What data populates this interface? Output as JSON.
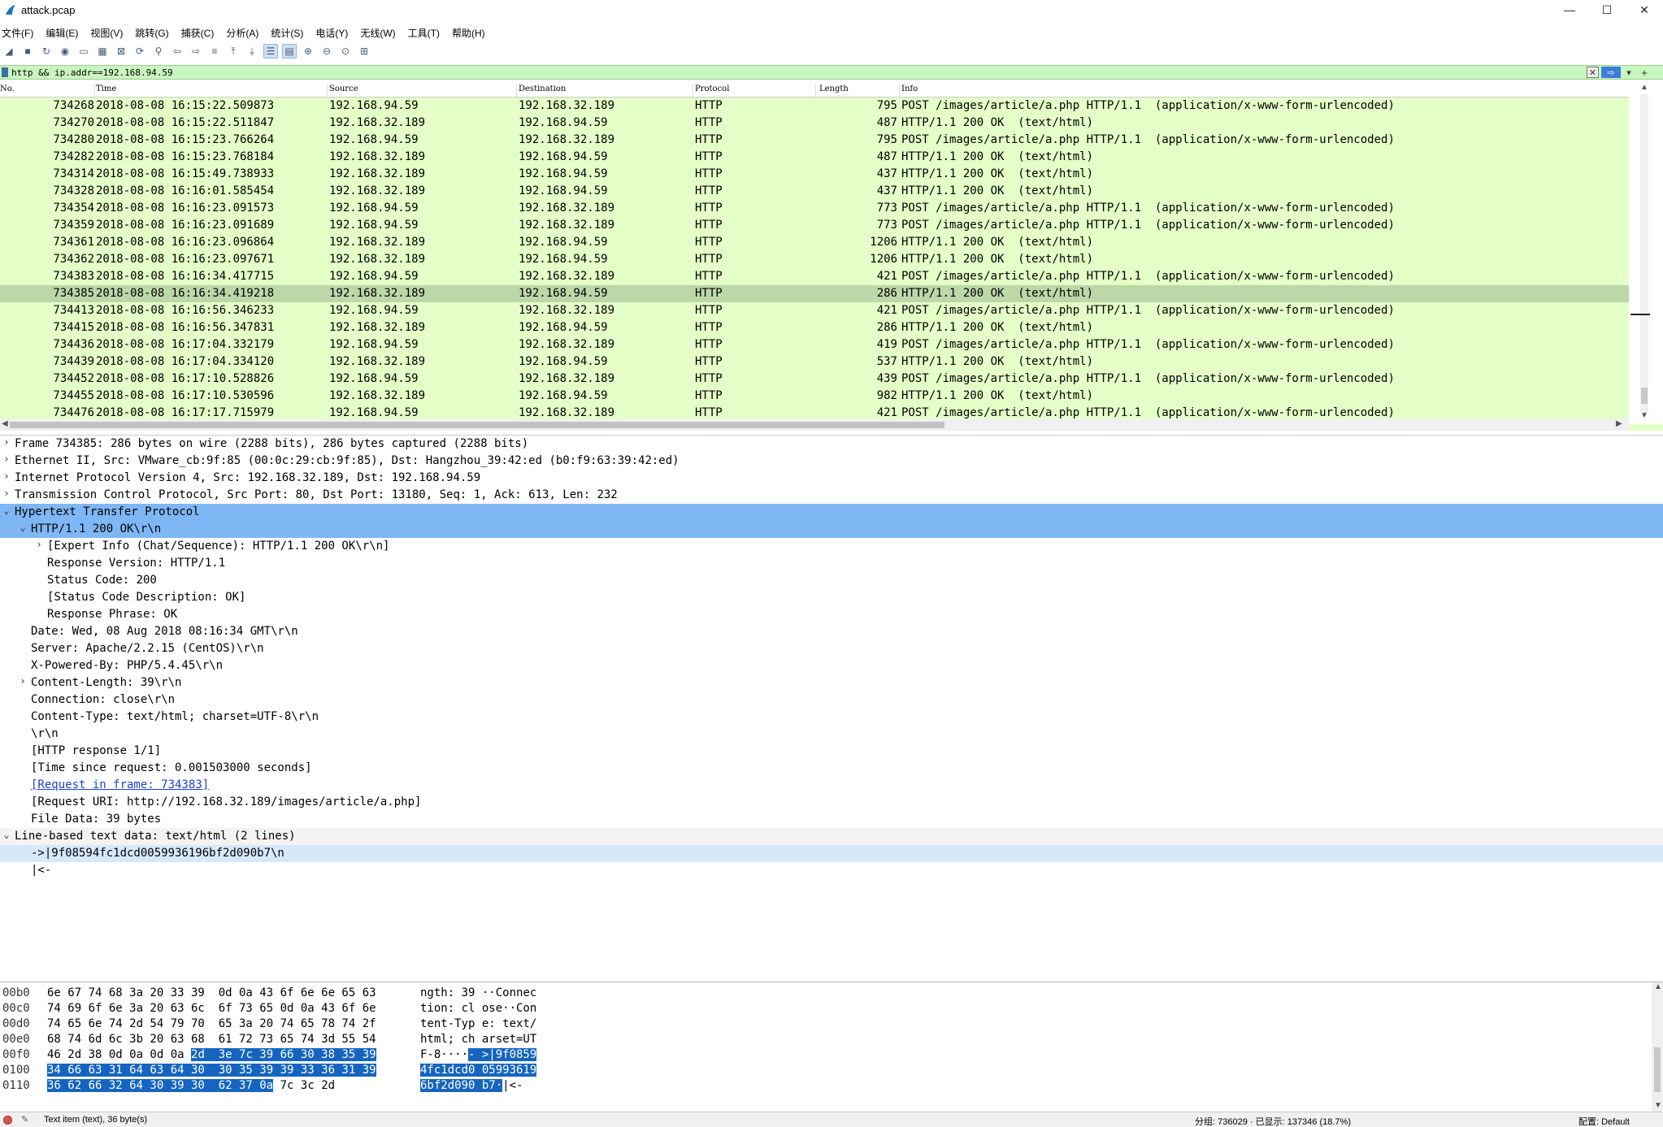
{
  "window": {
    "title": "attack.pcap",
    "minimize": "—",
    "maximize": "☐",
    "close": "✕"
  },
  "menu": [
    "文件(F)",
    "编辑(E)",
    "视图(V)",
    "跳转(G)",
    "捕获(C)",
    "分析(A)",
    "统计(S)",
    "电话(Y)",
    "无线(W)",
    "工具(T)",
    "帮助(H)"
  ],
  "toolbar_icons": [
    "shark-fin-start-icon",
    "stop-icon",
    "restart-icon",
    "options-icon",
    "open-file-icon",
    "save-icon",
    "close-file-icon",
    "reload-icon",
    "find-icon",
    "go-back-icon",
    "go-forward-icon",
    "go-to-packet-icon",
    "first-packet-icon",
    "last-packet-icon",
    "autoscroll-icon",
    "colorize-icon",
    "zoom-in-icon",
    "zoom-out-icon",
    "normal-size-icon",
    "resize-columns-icon"
  ],
  "filter": {
    "value": "http && ip.addr==192.168.94.59",
    "clear": "✕",
    "apply": "⇨",
    "dropdown": "▾",
    "add": "+"
  },
  "packet_list": {
    "columns": [
      "No.",
      "Time",
      "Source",
      "Destination",
      "Protocol",
      "Length",
      "Info"
    ],
    "rows": [
      {
        "no": "734268",
        "time": "2018-08-08 16:15:22.509873",
        "src": "192.168.94.59",
        "dst": "192.168.32.189",
        "proto": "HTTP",
        "len": "795",
        "info": "POST /images/article/a.php HTTP/1.1  (application/x-www-form-urlencoded)"
      },
      {
        "no": "734270",
        "time": "2018-08-08 16:15:22.511847",
        "src": "192.168.32.189",
        "dst": "192.168.94.59",
        "proto": "HTTP",
        "len": "487",
        "info": "HTTP/1.1 200 OK  (text/html)"
      },
      {
        "no": "734280",
        "time": "2018-08-08 16:15:23.766264",
        "src": "192.168.94.59",
        "dst": "192.168.32.189",
        "proto": "HTTP",
        "len": "795",
        "info": "POST /images/article/a.php HTTP/1.1  (application/x-www-form-urlencoded)"
      },
      {
        "no": "734282",
        "time": "2018-08-08 16:15:23.768184",
        "src": "192.168.32.189",
        "dst": "192.168.94.59",
        "proto": "HTTP",
        "len": "487",
        "info": "HTTP/1.1 200 OK  (text/html)"
      },
      {
        "no": "734314",
        "time": "2018-08-08 16:15:49.738933",
        "src": "192.168.32.189",
        "dst": "192.168.94.59",
        "proto": "HTTP",
        "len": "437",
        "info": "HTTP/1.1 200 OK  (text/html)"
      },
      {
        "no": "734328",
        "time": "2018-08-08 16:16:01.585454",
        "src": "192.168.32.189",
        "dst": "192.168.94.59",
        "proto": "HTTP",
        "len": "437",
        "info": "HTTP/1.1 200 OK  (text/html)"
      },
      {
        "no": "734354",
        "time": "2018-08-08 16:16:23.091573",
        "src": "192.168.94.59",
        "dst": "192.168.32.189",
        "proto": "HTTP",
        "len": "773",
        "info": "POST /images/article/a.php HTTP/1.1  (application/x-www-form-urlencoded)"
      },
      {
        "no": "734359",
        "time": "2018-08-08 16:16:23.091689",
        "src": "192.168.94.59",
        "dst": "192.168.32.189",
        "proto": "HTTP",
        "len": "773",
        "info": "POST /images/article/a.php HTTP/1.1  (application/x-www-form-urlencoded)"
      },
      {
        "no": "734361",
        "time": "2018-08-08 16:16:23.096864",
        "src": "192.168.32.189",
        "dst": "192.168.94.59",
        "proto": "HTTP",
        "len": "1206",
        "info": "HTTP/1.1 200 OK  (text/html)"
      },
      {
        "no": "734362",
        "time": "2018-08-08 16:16:23.097671",
        "src": "192.168.32.189",
        "dst": "192.168.94.59",
        "proto": "HTTP",
        "len": "1206",
        "info": "HTTP/1.1 200 OK  (text/html)"
      },
      {
        "no": "734383",
        "time": "2018-08-08 16:16:34.417715",
        "src": "192.168.94.59",
        "dst": "192.168.32.189",
        "proto": "HTTP",
        "len": "421",
        "info": "POST /images/article/a.php HTTP/1.1  (application/x-www-form-urlencoded)"
      },
      {
        "no": "734385",
        "time": "2018-08-08 16:16:34.419218",
        "src": "192.168.32.189",
        "dst": "192.168.94.59",
        "proto": "HTTP",
        "len": "286",
        "info": "HTTP/1.1 200 OK  (text/html)",
        "selected": true
      },
      {
        "no": "734413",
        "time": "2018-08-08 16:16:56.346233",
        "src": "192.168.94.59",
        "dst": "192.168.32.189",
        "proto": "HTTP",
        "len": "421",
        "info": "POST /images/article/a.php HTTP/1.1  (application/x-www-form-urlencoded)"
      },
      {
        "no": "734415",
        "time": "2018-08-08 16:16:56.347831",
        "src": "192.168.32.189",
        "dst": "192.168.94.59",
        "proto": "HTTP",
        "len": "286",
        "info": "HTTP/1.1 200 OK  (text/html)"
      },
      {
        "no": "734436",
        "time": "2018-08-08 16:17:04.332179",
        "src": "192.168.94.59",
        "dst": "192.168.32.189",
        "proto": "HTTP",
        "len": "419",
        "info": "POST /images/article/a.php HTTP/1.1  (application/x-www-form-urlencoded)"
      },
      {
        "no": "734439",
        "time": "2018-08-08 16:17:04.334120",
        "src": "192.168.32.189",
        "dst": "192.168.94.59",
        "proto": "HTTP",
        "len": "537",
        "info": "HTTP/1.1 200 OK  (text/html)"
      },
      {
        "no": "734452",
        "time": "2018-08-08 16:17:10.528826",
        "src": "192.168.94.59",
        "dst": "192.168.32.189",
        "proto": "HTTP",
        "len": "439",
        "info": "POST /images/article/a.php HTTP/1.1  (application/x-www-form-urlencoded)"
      },
      {
        "no": "734455",
        "time": "2018-08-08 16:17:10.530596",
        "src": "192.168.32.189",
        "dst": "192.168.94.59",
        "proto": "HTTP",
        "len": "982",
        "info": "HTTP/1.1 200 OK  (text/html)"
      },
      {
        "no": "734476",
        "time": "2018-08-08 16:17:17.715979",
        "src": "192.168.94.59",
        "dst": "192.168.32.189",
        "proto": "HTTP",
        "len": "421",
        "info": "POST /images/article/a.php HTTP/1.1  (application/x-www-form-urlencoded)"
      }
    ]
  },
  "details": [
    {
      "indent": 0,
      "toggle": "›",
      "text": "Frame 734385: 286 bytes on wire (2288 bits), 286 bytes captured (2288 bits)"
    },
    {
      "indent": 0,
      "toggle": "›",
      "text": "Ethernet II, Src: VMware_cb:9f:85 (00:0c:29:cb:9f:85), Dst: Hangzhou_39:42:ed (b0:f9:63:39:42:ed)"
    },
    {
      "indent": 0,
      "toggle": "›",
      "text": "Internet Protocol Version 4, Src: 192.168.32.189, Dst: 192.168.94.59"
    },
    {
      "indent": 0,
      "toggle": "›",
      "text": "Transmission Control Protocol, Src Port: 80, Dst Port: 13180, Seq: 1, Ack: 613, Len: 232"
    },
    {
      "indent": 0,
      "toggle": "⌄",
      "text": "Hypertext Transfer Protocol",
      "style": "hl"
    },
    {
      "indent": 1,
      "toggle": "⌄",
      "text": "HTTP/1.1 200 OK\\r\\n",
      "style": "hl"
    },
    {
      "indent": 2,
      "toggle": "›",
      "text": "[Expert Info (Chat/Sequence): HTTP/1.1 200 OK\\r\\n]"
    },
    {
      "indent": 2,
      "toggle": "",
      "text": "Response Version: HTTP/1.1"
    },
    {
      "indent": 2,
      "toggle": "",
      "text": "Status Code: 200"
    },
    {
      "indent": 2,
      "toggle": "",
      "text": "[Status Code Description: OK]"
    },
    {
      "indent": 2,
      "toggle": "",
      "text": "Response Phrase: OK"
    },
    {
      "indent": 1,
      "toggle": "",
      "text": "Date: Wed, 08 Aug 2018 08:16:34 GMT\\r\\n"
    },
    {
      "indent": 1,
      "toggle": "",
      "text": "Server: Apache/2.2.15 (CentOS)\\r\\n"
    },
    {
      "indent": 1,
      "toggle": "",
      "text": "X-Powered-By: PHP/5.4.45\\r\\n"
    },
    {
      "indent": 1,
      "toggle": "›",
      "text": "Content-Length: 39\\r\\n"
    },
    {
      "indent": 1,
      "toggle": "",
      "text": "Connection: close\\r\\n"
    },
    {
      "indent": 1,
      "toggle": "",
      "text": "Content-Type: text/html; charset=UTF-8\\r\\n"
    },
    {
      "indent": 1,
      "toggle": "",
      "text": "\\r\\n"
    },
    {
      "indent": 1,
      "toggle": "",
      "text": "[HTTP response 1/1]"
    },
    {
      "indent": 1,
      "toggle": "",
      "text": "[Time since request: 0.001503000 seconds]"
    },
    {
      "indent": 1,
      "toggle": "",
      "text": "[Request in frame: 734383]",
      "style": "link"
    },
    {
      "indent": 1,
      "toggle": "",
      "text": "[Request URI: http://192.168.32.189/images/article/a.php]"
    },
    {
      "indent": 1,
      "toggle": "",
      "text": "File Data: 39 bytes"
    },
    {
      "indent": 0,
      "toggle": "⌄",
      "text": "Line-based text data: text/html (2 lines)",
      "style": "gray"
    },
    {
      "indent": 1,
      "toggle": "",
      "text": "->|9f08594fc1dcd0059936196bf2d090b7\\n",
      "style": "hl2"
    },
    {
      "indent": 1,
      "toggle": "",
      "text": "|<-"
    }
  ],
  "hex": [
    {
      "off": "00b0",
      "hex": "6e 67 74 68 3a 20 33 39  0d 0a 43 6f 6e 6e 65 63",
      "ascii": "ngth: 39 ··Connec"
    },
    {
      "off": "00c0",
      "hex": "74 69 6f 6e 3a 20 63 6c  6f 73 65 0d 0a 43 6f 6e",
      "ascii": "tion: cl ose··Con"
    },
    {
      "off": "00d0",
      "hex": "74 65 6e 74 2d 54 79 70  65 3a 20 74 65 78 74 2f",
      "ascii": "tent-Typ e: text/"
    },
    {
      "off": "00e0",
      "hex": "68 74 6d 6c 3b 20 63 68  61 72 73 65 74 3d 55 54",
      "ascii": "html; ch arset=UT"
    },
    {
      "off": "00f0",
      "hex_pre": "46 2d 38 0d 0a 0d 0a ",
      "hex_sel": "2d  3e 7c 39 66 30 38 35 39",
      "hex_post": "",
      "ascii_pre": "F-8····",
      "ascii_sel": "- >|9f0859",
      "ascii_post": ""
    },
    {
      "off": "0100",
      "hex_pre": "",
      "hex_sel": "34 66 63 31 64 63 64 30  30 35 39 39 33 36 31 39",
      "hex_post": "",
      "ascii_pre": "",
      "ascii_sel": "4fc1dcd0 05993619",
      "ascii_post": ""
    },
    {
      "off": "0110",
      "hex_pre": "",
      "hex_sel": "36 62 66 32 64 30 39 30  62 37 0a",
      "hex_post": " 7c 3c 2d",
      "ascii_pre": "",
      "ascii_sel": "6bf2d090 b7·",
      "ascii_post": "|<-"
    }
  ],
  "status": {
    "left": "Text item (text), 36 byte(s)",
    "packets": "分组: 736029 · 已显示: 137346 (18.7%)",
    "profile": "配置: Default"
  }
}
